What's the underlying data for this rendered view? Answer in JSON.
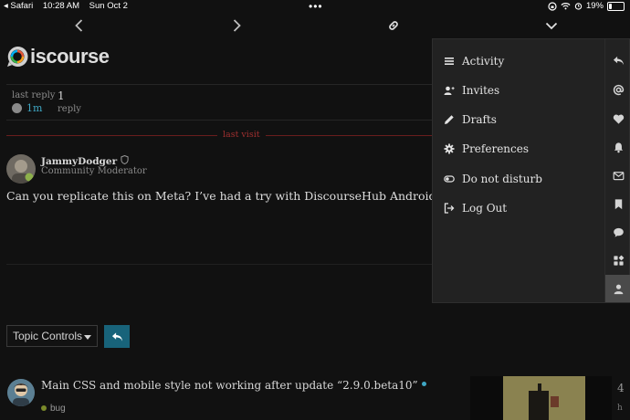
{
  "status_bar": {
    "back_app": "◂ Safari",
    "time": "10:28 AM",
    "date": "Sun Oct 2",
    "battery": "19%",
    "battery_level": 0.19
  },
  "header": {
    "logo_text": "iscourse"
  },
  "topic_summary": {
    "last_reply_label": "last reply",
    "last_reply_time": "1m",
    "reply_count": "1",
    "reply_label": "reply"
  },
  "last_visit_label": "last visit",
  "post": {
    "username": "JammyDodger",
    "role": "Community Moderator",
    "body": "Can you replicate this on Meta? I’ve had a try with DiscourseHub Android and iPhone a"
  },
  "controls": {
    "topic_controls_label": "Topic Controls"
  },
  "suggested": {
    "title": "Main CSS and mobile style not working after update “2.9.0.beta10”",
    "tag": "bug",
    "edge_count": "4",
    "edge_time": "h"
  },
  "user_menu": {
    "items": [
      {
        "label": "Activity",
        "icon": "list-icon"
      },
      {
        "label": "Invites",
        "icon": "user-plus-icon"
      },
      {
        "label": "Drafts",
        "icon": "pencil-icon"
      },
      {
        "label": "Preferences",
        "icon": "gear-icon"
      },
      {
        "label": "Do not disturb",
        "icon": "toggle-icon"
      },
      {
        "label": "Log Out",
        "icon": "sign-out-icon"
      }
    ],
    "tabs": [
      "reply-icon",
      "at-icon",
      "heart-icon",
      "bell-icon",
      "envelope-icon",
      "bookmark-icon",
      "comment-icon",
      "grid-icon",
      "user-icon"
    ],
    "active_tab": "user-icon"
  },
  "colors": {
    "background": "#111111",
    "accent": "#3fa7c4",
    "primary_button": "#18637a",
    "last_visit_line": "#a13030",
    "menu_panel": "#222222"
  }
}
